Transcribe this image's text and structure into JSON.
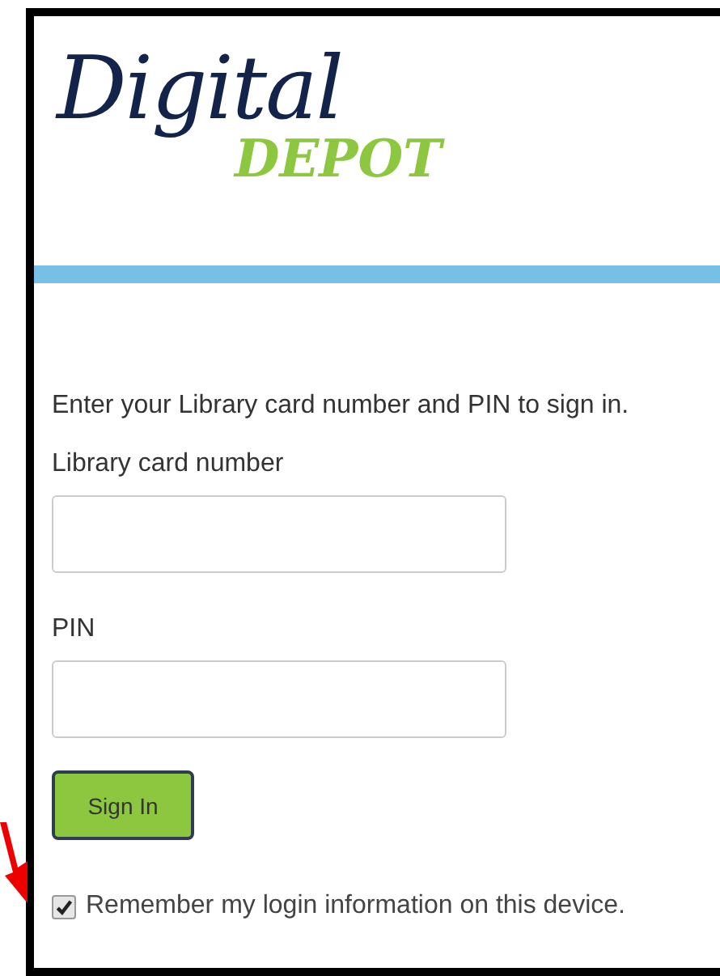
{
  "logo": {
    "script": "Digital",
    "block": "DEPOT"
  },
  "intro": "Enter your Library card number and PIN to sign in.",
  "fields": [
    {
      "label": "Library card number"
    },
    {
      "label": "PIN"
    }
  ],
  "sign_in_button": "Sign In",
  "remember": {
    "label": "Remember my login information on this device.",
    "checked": true
  }
}
